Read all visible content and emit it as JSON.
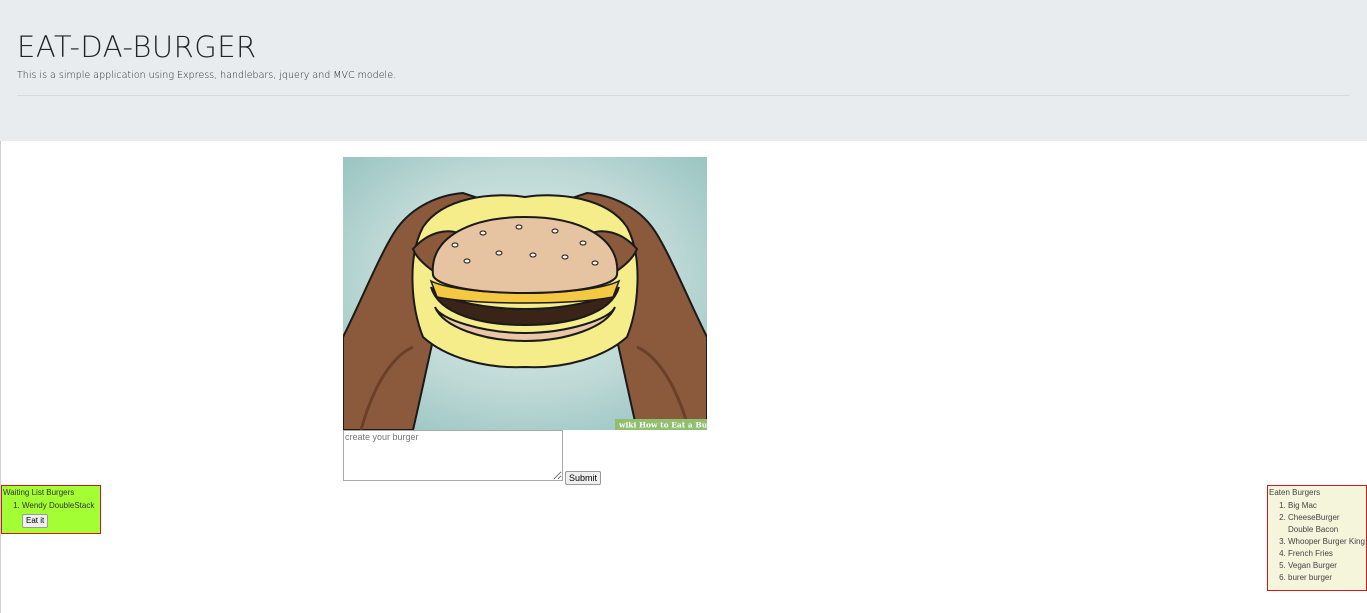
{
  "header": {
    "title": "EAT-DA-BURGER",
    "subtitle": "This is a simple application using Express, handlebars, jquery and MVC modele."
  },
  "image": {
    "watermark": "wiki How to Eat a Burger"
  },
  "form": {
    "placeholder": "create your burger",
    "submit_label": "Submit"
  },
  "waiting_list": {
    "title": "Waiting List Burgers",
    "items": [
      {
        "name": "Wendy DoubleStack",
        "button_label": "Eat it"
      }
    ],
    "background": "#a3ff33",
    "border": "#cc1a1a"
  },
  "eaten_list": {
    "title": "Eaten Burgers",
    "items": [
      "Big Mac",
      "CheeseBurger Double Bacon",
      "Whooper Burger King",
      "French Fries",
      "Vegan Burger",
      "burer burger"
    ],
    "background": "#f5f5dc",
    "border": "#cc1a1a"
  }
}
